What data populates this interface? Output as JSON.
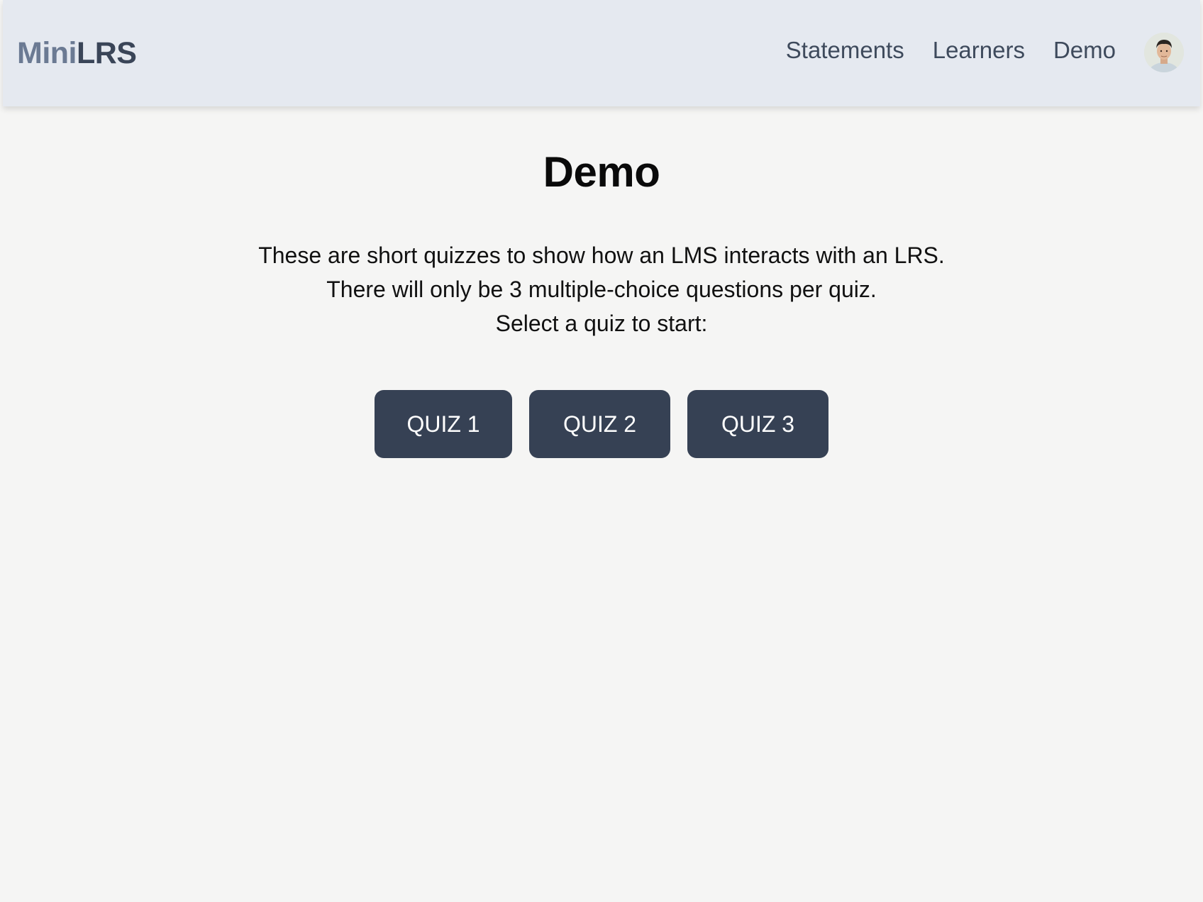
{
  "navbar": {
    "brand_part1": "Mini",
    "brand_part2": "LRS",
    "links": [
      {
        "label": "Statements"
      },
      {
        "label": "Learners"
      },
      {
        "label": "Demo"
      }
    ],
    "avatar_icon": "user-avatar"
  },
  "main": {
    "title": "Demo",
    "intro_lines": [
      "These are short quizzes to show how an LMS interacts with an LRS.",
      "There will only be 3 multiple-choice questions per quiz.",
      "Select a quiz to start:"
    ],
    "quizzes": [
      {
        "label": "QUIZ 1"
      },
      {
        "label": "QUIZ 2"
      },
      {
        "label": "QUIZ 3"
      }
    ]
  },
  "colors": {
    "navbar_bg": "#e5e9f0",
    "page_bg": "#f5f5f4",
    "button_bg": "#364154",
    "button_text": "#ffffff",
    "brand_mini": "#6b7a93",
    "brand_lrs": "#3a4558"
  }
}
